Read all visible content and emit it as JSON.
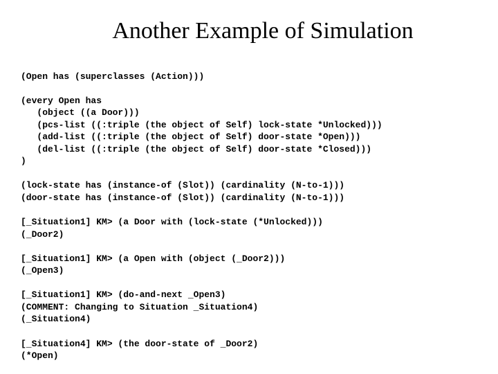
{
  "title": "Another Example of Simulation",
  "code": {
    "l01": "(Open has (superclasses (Action)))",
    "l02": "",
    "l03": "(every Open has",
    "l04": "   (object ((a Door)))",
    "l05": "   (pcs-list ((:triple (the object of Self) lock-state *Unlocked)))",
    "l06": "   (add-list ((:triple (the object of Self) door-state *Open)))",
    "l07": "   (del-list ((:triple (the object of Self) door-state *Closed)))",
    "l08": ")",
    "l09": "",
    "l10": "(lock-state has (instance-of (Slot)) (cardinality (N-to-1)))",
    "l11": "(door-state has (instance-of (Slot)) (cardinality (N-to-1)))",
    "l12": "",
    "l13": "[_Situation1] KM> (a Door with (lock-state (*Unlocked)))",
    "l14": "(_Door2)",
    "l15": "",
    "l16": "[_Situation1] KM> (a Open with (object (_Door2)))",
    "l17": "(_Open3)",
    "l18": "",
    "l19": "[_Situation1] KM> (do-and-next _Open3)",
    "l20": "(COMMENT: Changing to Situation _Situation4)",
    "l21": "(_Situation4)",
    "l22": "",
    "l23": "[_Situation4] KM> (the door-state of _Door2)",
    "l24": "(*Open)"
  }
}
